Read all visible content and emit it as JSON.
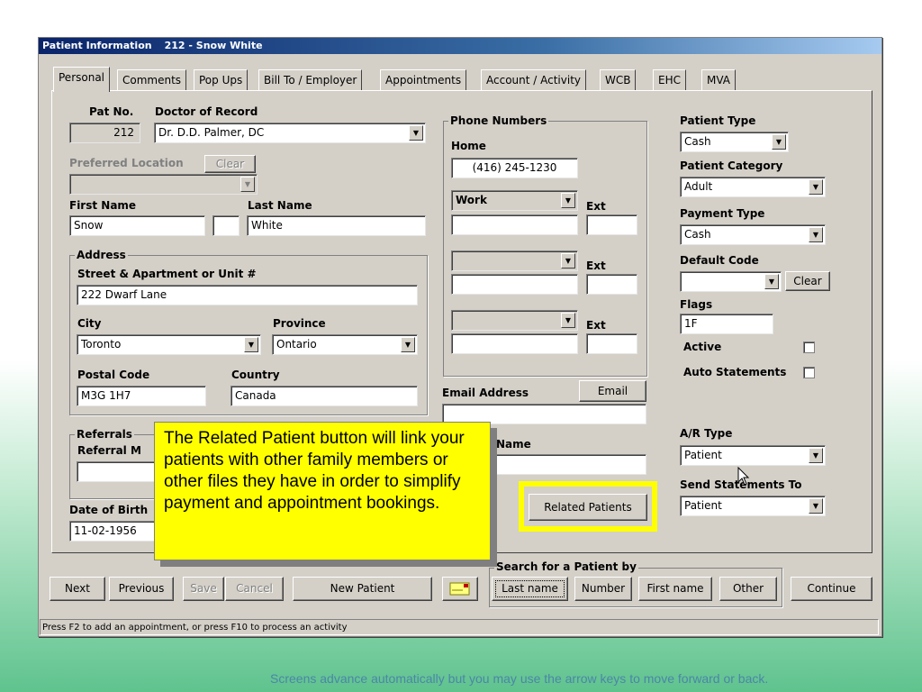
{
  "window": {
    "title_app": "Patient Information",
    "title_record": "212 - Snow White"
  },
  "tabs": [
    "Personal",
    "Comments",
    "Pop Ups",
    "Bill To / Employer",
    "Appointments",
    "Account / Activity",
    "WCB",
    "EHC",
    "MVA"
  ],
  "personal": {
    "pat_no_label": "Pat No.",
    "pat_no": "212",
    "doctor_label": "Doctor of Record",
    "doctor": "Dr. D.D. Palmer, DC",
    "pref_loc_label": "Preferred Location",
    "pref_loc_clear": "Clear",
    "first_name_label": "First Name",
    "first_name": "Snow",
    "last_name_label": "Last Name",
    "last_name": "White",
    "address_group": "Address",
    "street_label": "Street  &  Apartment or Unit #",
    "street": "222 Dwarf Lane",
    "city_label": "City",
    "city": "Toronto",
    "province_label": "Province",
    "province": "Ontario",
    "postal_label": "Postal Code",
    "postal": "M3G 1H7",
    "country_label": "Country",
    "country": "Canada",
    "referrals_group": "Referrals",
    "referral_label": "Referral  M",
    "dob_label": "Date of Birth",
    "dob": "11-02-1956"
  },
  "phones": {
    "group": "Phone Numbers",
    "home_label": "Home",
    "home": "(416) 245-1230",
    "work_type": "Work",
    "ext_label": "Ext",
    "email_label": "Email Address",
    "email_button": "Email",
    "name_label": "Name",
    "related_button": "Related Patients"
  },
  "right": {
    "patient_type_label": "Patient Type",
    "patient_type": "Cash",
    "patient_category_label": "Patient Category",
    "patient_category": "Adult",
    "payment_type_label": "Payment Type",
    "payment_type": "Cash",
    "default_code_label": "Default Code",
    "default_code_clear": "Clear",
    "flags_label": "Flags",
    "flags": "1F",
    "active_label": "Active",
    "auto_statements_label": "Auto Statements",
    "ar_type_label": "A/R Type",
    "ar_type": "Patient",
    "send_statements_label": "Send Statements To",
    "send_statements": "Patient"
  },
  "bottom": {
    "next": "Next",
    "previous": "Previous",
    "save": "Save",
    "cancel": "Cancel",
    "new_patient": "New Patient",
    "search_group": "Search for a Patient by",
    "last_name": "Last name",
    "number": "Number",
    "first_name": "First name",
    "other": "Other",
    "continue": "Continue"
  },
  "status_text": "Press F2 to add an appointment,    or press F10 to process an activity",
  "callout_text": "The Related Patient button will link your patients with other family members or other files they have in order to simplify payment and appointment bookings.",
  "footer_text": "Screens advance automatically but you may use the arrow keys to move forward or back."
}
